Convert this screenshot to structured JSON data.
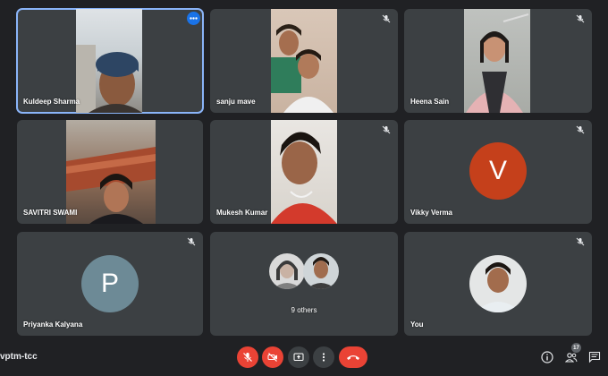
{
  "meeting": {
    "code": "vptm-tcc"
  },
  "participants": [
    {
      "name": "Kuldeep Sharma",
      "muted": false,
      "active": true
    },
    {
      "name": "sanju mave",
      "muted": true
    },
    {
      "name": "Heena Sain",
      "muted": true
    },
    {
      "name": "SAVITRI SWAMI",
      "muted": false
    },
    {
      "name": "Mukesh Kumar",
      "muted": true
    },
    {
      "name": "Vikky Verma",
      "muted": true,
      "avatar_letter": "V",
      "avatar_color": "#c5401b"
    },
    {
      "name": "Priyanka Kalyana",
      "muted": true,
      "avatar_letter": "P",
      "avatar_color": "#6d8a96"
    },
    {
      "others_label": "9 others"
    },
    {
      "name": "You",
      "muted": true
    }
  ],
  "controls": {
    "mic": {
      "icon": "mic-off-icon",
      "state": "off",
      "color": "#ea4335"
    },
    "camera": {
      "icon": "camera-off-icon",
      "state": "off",
      "color": "#ea4335"
    },
    "present": {
      "icon": "present-screen-icon"
    },
    "more": {
      "icon": "more-options-icon"
    },
    "end_call": {
      "icon": "end-call-icon",
      "color": "#ea4335"
    }
  },
  "side_panel": {
    "info_icon": "info-icon",
    "people_icon": "people-icon",
    "people_count": "17",
    "chat_icon": "chat-icon"
  },
  "colors": {
    "background": "#202124",
    "tile": "#3c4043",
    "active_border": "#8ab4f8"
  }
}
